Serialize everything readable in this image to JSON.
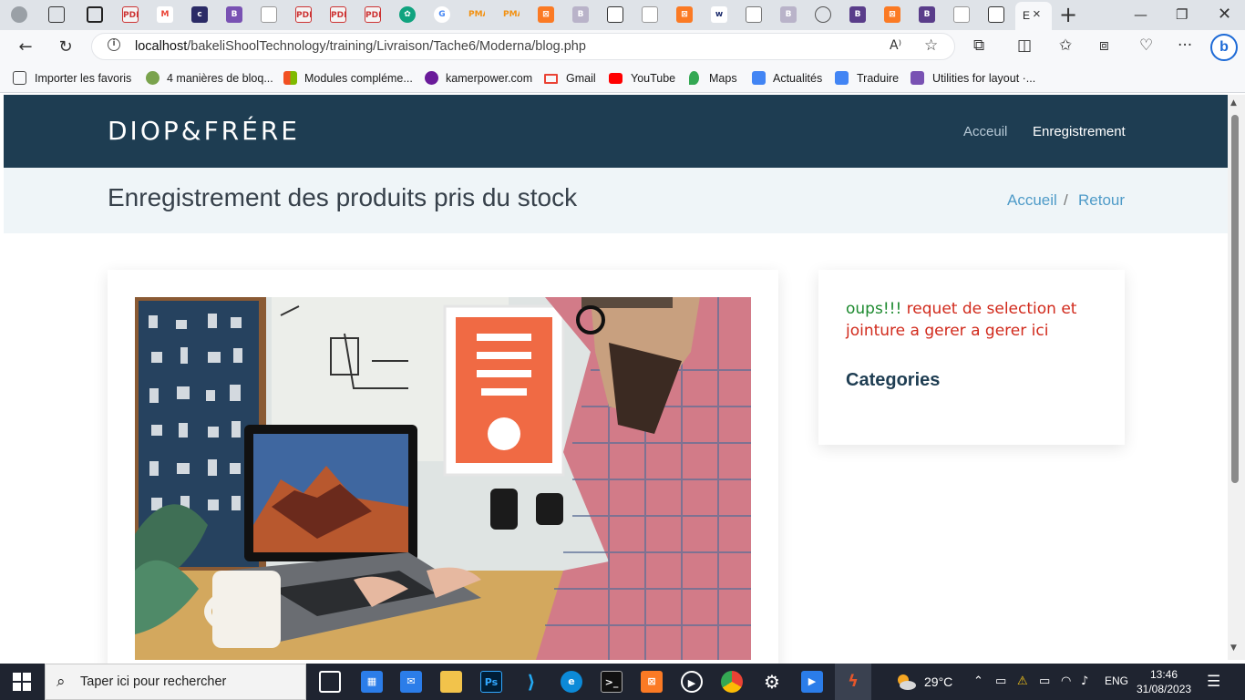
{
  "browser": {
    "active_tab_label": "E",
    "tab_icons": [
      "person-icon",
      "workspaces-icon",
      "tab-actions-icon",
      "pdf-icon",
      "gmail-icon",
      "colorlib-icon",
      "bootstrap-icon",
      "file-icon",
      "pdf-icon",
      "pdf-icon",
      "pdf-icon",
      "chatgpt-icon",
      "google-icon",
      "phpmyadmin-icon",
      "phpmyadmin-icon",
      "xampp-icon",
      "bootstrap-icon",
      "file-icon",
      "file-icon",
      "xampp-icon",
      "wave-icon",
      "window-icon",
      "bootstrap-icon",
      "globe-icon",
      "bootstrap-icon",
      "xampp-icon",
      "bootstrap-icon",
      "file-icon",
      "sync-icon"
    ],
    "url_host": "localhost",
    "url_path": "/bakeliShoolTechnology/training/Livraison/Tache6/Moderna/blog.php",
    "bookmarks": [
      {
        "label": "Importer les favoris",
        "icon": "import-icon",
        "color": "#444444"
      },
      {
        "label": "4 manières de bloq...",
        "icon": "wikihow-icon",
        "color": "#7aa34d"
      },
      {
        "label": "Modules compléme...",
        "icon": "microsoft-icon",
        "color": "#f25022"
      },
      {
        "label": "kamerpower.com",
        "icon": "kamerpower-icon",
        "color": "#6a1b9a"
      },
      {
        "label": "Gmail",
        "icon": "gmail-icon",
        "color": "#ea4335"
      },
      {
        "label": "YouTube",
        "icon": "youtube-icon",
        "color": "#ff0000"
      },
      {
        "label": "Maps",
        "icon": "maps-icon",
        "color": "#34a853"
      },
      {
        "label": "Actualités",
        "icon": "news-icon",
        "color": "#4285f4"
      },
      {
        "label": "Traduire",
        "icon": "translate-icon",
        "color": "#4285f4"
      },
      {
        "label": "Utilities for layout ·...",
        "icon": "bootstrap-icon",
        "color": "#7952b3"
      }
    ]
  },
  "site": {
    "brand": "DIOP&FRÉRE",
    "nav": {
      "home": "Acceuil",
      "register": "Enregistrement"
    },
    "page_title": "Enregistrement des produits pris du stock",
    "breadcrumb": {
      "home": "Accueil",
      "separator": "/",
      "back": "Retour"
    },
    "sidebar": {
      "msg_ok": "oups!!!",
      "msg_err": " requet de selection et jointure a gerer a gerer ici",
      "categories_title": "Categories"
    },
    "colors": {
      "header": "#1e3d52",
      "title_bar": "#eff5f8",
      "link": "#4f9bc8",
      "error": "#d12a1c",
      "ok": "#1d8a2f"
    }
  },
  "taskbar": {
    "search_placeholder": "Taper ici pour rechercher",
    "apps": [
      "task-view-icon",
      "store-icon",
      "mail-icon",
      "file-explorer-icon",
      "photoshop-icon",
      "vscode-icon",
      "edge-icon",
      "terminal-icon",
      "xampp-icon",
      "media-player-icon",
      "chrome-icon",
      "settings-icon",
      "movie-icon",
      "git-icon"
    ],
    "temperature": "29°C",
    "language": "ENG",
    "time": "13:46",
    "date": "31/08/2023"
  }
}
